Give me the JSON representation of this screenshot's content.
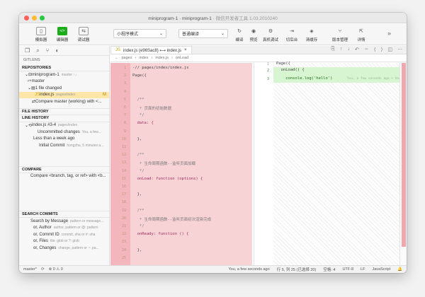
{
  "window": {
    "title": "miniprogram-1 · miniprogram-1",
    "subtitle": "· 微信开发者工具 1.03.2010240"
  },
  "toolbar": {
    "buttons": [
      {
        "label": "模拟器",
        "icon": "phone-icon",
        "glyph": "▯"
      },
      {
        "label": "编辑器",
        "icon": "code-icon",
        "glyph": "</>"
      },
      {
        "label": "调试器",
        "icon": "debug-icon",
        "glyph": "⇆"
      }
    ],
    "mode_select": "小程序模式",
    "compile_select": "普通编译",
    "right_buttons": [
      {
        "label": "编译",
        "icon": "refresh-icon",
        "glyph": "↻"
      },
      {
        "label": "预览",
        "icon": "eye-icon",
        "glyph": "◉"
      },
      {
        "label": "真机调试",
        "icon": "remote-debug-icon",
        "glyph": "⚙"
      },
      {
        "label": "切后台",
        "icon": "background-icon",
        "glyph": "⇥"
      },
      {
        "label": "清缓存",
        "icon": "clear-cache-icon",
        "glyph": "◈"
      },
      {
        "label": "版本管理",
        "icon": "version-icon",
        "glyph": "⑂"
      },
      {
        "label": "详情",
        "icon": "details-icon",
        "glyph": "⇱"
      }
    ],
    "more": "»"
  },
  "sidebar": {
    "header": "GITLENS",
    "repositories": {
      "title": "REPOSITORIES",
      "repo": "miniprogram-1",
      "repo_meta": "master ↑↓",
      "branch": "master",
      "changed": "1 file changed",
      "file": "index.js",
      "file_meta": "pages/index",
      "file_status": "M",
      "compare": "Compare master (working) with <..."
    },
    "file_history": "FILE HISTORY",
    "line_history": {
      "title": "LINE HISTORY",
      "item": "index.js #3-4",
      "item_meta": "pages/index",
      "uncommitted": "Uncommitted changes",
      "uncommitted_meta": "You, a few...",
      "less_week": "Less than a week ago",
      "initial": "Initial Commit",
      "initial_meta": "hongzhu, 5 minutes a..."
    },
    "compare": {
      "title": "COMPARE",
      "item": "Compare <branch, tag, or ref> with <b..."
    },
    "search": {
      "title": "SEARCH COMMITS",
      "items": [
        {
          "label": "Search by Message",
          "meta": "pattern or message..."
        },
        {
          "label": "or, Author",
          "meta": "author, pattern or @: pattern"
        },
        {
          "label": "or, Commit ID",
          "meta": "commit, sha or #: sha"
        },
        {
          "label": "or, Files",
          "meta": "file: glob or ?: glob"
        },
        {
          "label": "or, Changes",
          "meta": "change, pattern or ~: pa..."
        }
      ]
    }
  },
  "editor": {
    "tab": "index.js (e96Sac8) ⟷ index.js",
    "crumbs": [
      "pages",
      "index",
      "index.js",
      "onLoad"
    ],
    "left_lines": [
      {
        "n": "1",
        "t": "-// pages/index/index.js"
      },
      {
        "n": "2",
        "t": "Page({"
      },
      {
        "n": "3",
        "t": ""
      },
      {
        "n": "4",
        "t": ""
      },
      {
        "n": "5",
        "t": "  /**"
      },
      {
        "n": "6",
        "t": "   * 页面的初始数据"
      },
      {
        "n": "7",
        "t": "   */"
      },
      {
        "n": "8",
        "t": "  data: {"
      },
      {
        "n": "9",
        "t": ""
      },
      {
        "n": "10",
        "t": "  },"
      },
      {
        "n": "11",
        "t": ""
      },
      {
        "n": "12",
        "t": "  /**"
      },
      {
        "n": "13",
        "t": "   * 生命周期函数--监听页面加载"
      },
      {
        "n": "14",
        "t": "   */"
      },
      {
        "n": "15",
        "t": "  onLoad: function (options) {"
      },
      {
        "n": "16",
        "t": ""
      },
      {
        "n": "17",
        "t": "  },"
      },
      {
        "n": "18",
        "t": ""
      },
      {
        "n": "19",
        "t": "  /**"
      },
      {
        "n": "20",
        "t": "   * 生命周期函数--监听页面初次渲染完成"
      },
      {
        "n": "21",
        "t": "   */"
      },
      {
        "n": "22",
        "t": "  onReady: function () {"
      },
      {
        "n": "23",
        "t": ""
      },
      {
        "n": "24",
        "t": "  },"
      },
      {
        "n": "25",
        "t": ""
      }
    ],
    "right_lines": [
      {
        "n": "1",
        "t": "Page({"
      },
      {
        "n": "2",
        "t": "  onLoad() {"
      },
      {
        "n": "3",
        "t": "    console.log('hello')"
      }
    ],
    "blame": "You, a few seconds ago • Uncommitted changes"
  },
  "status": {
    "branch": "master*",
    "sync": "⟳",
    "errors": "⊗ 0 ⚠ 0",
    "blame": "You, a few seconds ago",
    "position": "行 5, 列 25 (已选择 20)",
    "indent": "空格: 4",
    "encoding": "UTF-8",
    "eol": "LF",
    "lang": "JavaScript"
  },
  "colors": {
    "accent": "#1aad19",
    "deleted": "#f8d3d6",
    "added": "#d7f5d0"
  }
}
